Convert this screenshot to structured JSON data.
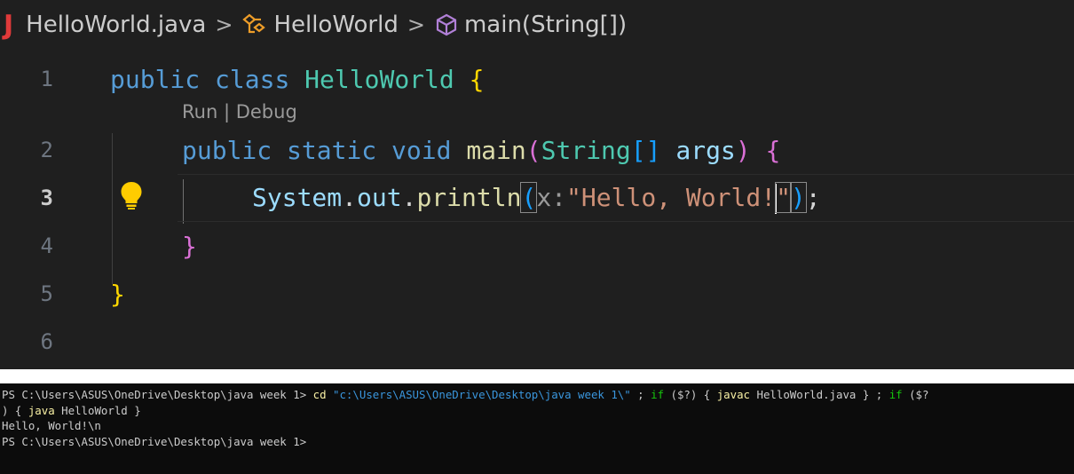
{
  "breadcrumb": {
    "file_icon": "J",
    "file": "HelloWorld.java",
    "separator": ">",
    "class": "HelloWorld",
    "method": "main(String[])"
  },
  "editor": {
    "line_numbers": [
      "1",
      "2",
      "3",
      "4",
      "5",
      "6"
    ],
    "codelens": {
      "run": "Run",
      "divider": " | ",
      "debug": "Debug"
    },
    "tokens": {
      "public": "public",
      "class": "class",
      "static": "static",
      "void": "void",
      "class_name": "HelloWorld",
      "main": "main",
      "string_type": "String",
      "array_brackets": "[]",
      "args": "args",
      "open_paren": "(",
      "close_paren": ")",
      "open_brace": "{",
      "close_brace": "}",
      "system": "System",
      "dot": ".",
      "out": "out",
      "println": "println",
      "param_hint": "x:",
      "string_literal_body": "\"Hello, World!",
      "string_literal_end": "\"",
      "semicolon": ";"
    }
  },
  "terminal": {
    "line1": {
      "prompt": "PS C:\\Users\\ASUS\\OneDrive\\Desktop\\java week 1> ",
      "cd": "cd",
      "path": "\"c:\\Users\\ASUS\\OneDrive\\Desktop\\java week 1\\\"",
      "sep1": " ; ",
      "if1": "if",
      "cond1": " ($?) { ",
      "javac": "javac",
      "javac_arg": " HelloWorld.java } ; ",
      "if2": "if",
      "cond2": " ($?"
    },
    "line2": {
      "close": ") { ",
      "java": "java",
      "java_arg": " HelloWorld }"
    },
    "output": "Hello, World!\\n",
    "prompt_final": "PS C:\\Users\\ASUS\\OneDrive\\Desktop\\java week 1>"
  },
  "colors": {
    "editor_bg": "#1f1f1f",
    "terminal_bg": "#0c0c0c",
    "keyword": "#569cd6",
    "class": "#4ec9b0",
    "function": "#dcdcaa",
    "variable": "#9cdcfe",
    "string": "#ce9178",
    "bracket_1": "#ffd700",
    "bracket_2": "#da70d6",
    "bracket_3": "#179fff",
    "java_icon": "#e03a3a",
    "lightbulb": "#ffcc00"
  },
  "icons": {
    "file_type": "java-file-icon",
    "class_symbol": "class-symbol-icon",
    "method_symbol": "method-cube-icon",
    "quick_fix": "lightbulb-icon"
  }
}
